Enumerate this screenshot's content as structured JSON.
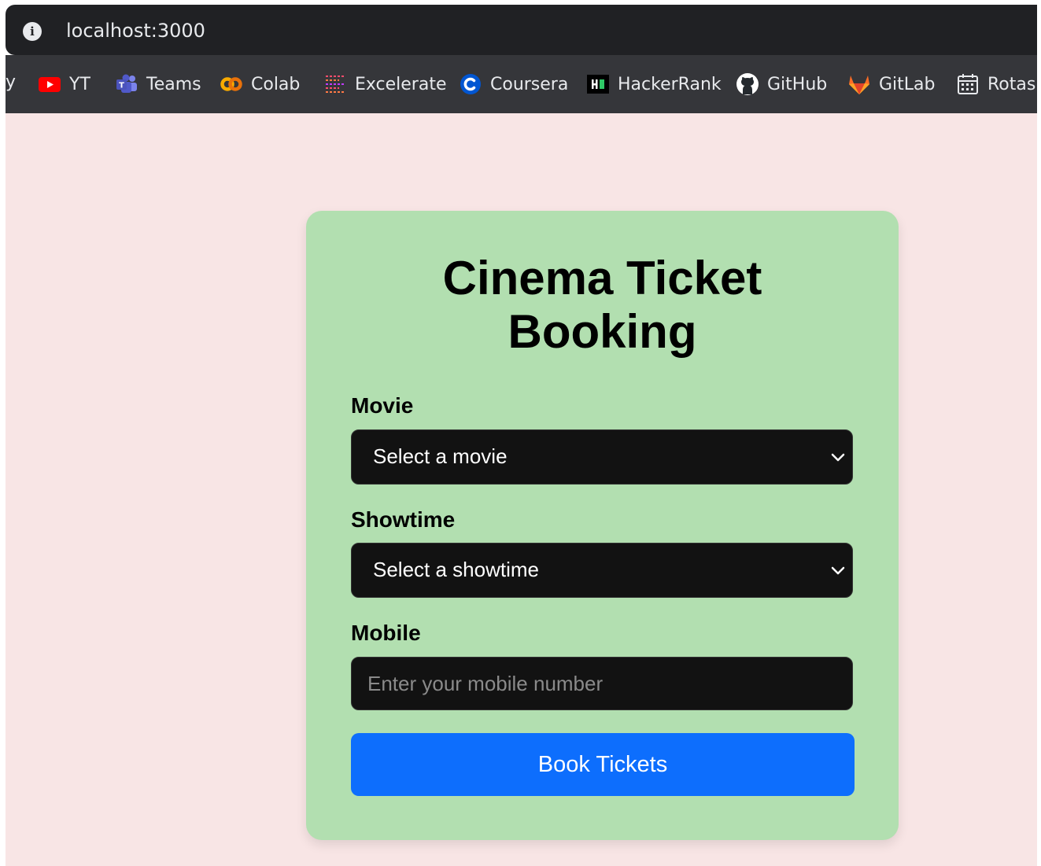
{
  "browser": {
    "url": "localhost:3000",
    "bookmarks_truncated_text": "y",
    "bookmarks": [
      {
        "label": "YT",
        "icon": "youtube-icon"
      },
      {
        "label": "Teams",
        "icon": "teams-icon"
      },
      {
        "label": "Colab",
        "icon": "colab-icon"
      },
      {
        "label": "Excelerate",
        "icon": "excelerate-icon"
      },
      {
        "label": "Coursera",
        "icon": "coursera-icon"
      },
      {
        "label": "HackerRank",
        "icon": "hackerrank-icon"
      },
      {
        "label": "GitHub",
        "icon": "github-icon"
      },
      {
        "label": "GitLab",
        "icon": "gitlab-icon"
      },
      {
        "label": "Rotas",
        "icon": "calendar-icon"
      }
    ]
  },
  "form": {
    "title_line1": "Cinema Ticket",
    "title_line2": "Booking",
    "movie": {
      "label": "Movie",
      "selected": "Select a movie"
    },
    "showtime": {
      "label": "Showtime",
      "selected": "Select a showtime"
    },
    "mobile": {
      "label": "Mobile",
      "placeholder": "Enter your mobile number",
      "value": ""
    },
    "submit_label": "Book Tickets"
  },
  "colors": {
    "page_background": "#f8e5e5",
    "card_background": "#b2dfb0",
    "field_background": "#121212",
    "button_background": "#0d6efd",
    "browser_chrome": "#35363a"
  }
}
